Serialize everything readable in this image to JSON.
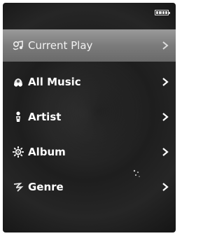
{
  "status_bar": {
    "battery_icon": "battery-full-icon",
    "battery_level": 1.0
  },
  "menu": {
    "items": [
      {
        "label": "Current Play",
        "icon": "now-playing-icon",
        "selected": true
      },
      {
        "label": "All Music",
        "icon": "music-notes-icon",
        "selected": false
      },
      {
        "label": "Artist",
        "icon": "artist-icon",
        "selected": false
      },
      {
        "label": "Album",
        "icon": "album-icon",
        "selected": false
      },
      {
        "label": "Genre",
        "icon": "genre-icon",
        "selected": false
      }
    ],
    "chevron_icon": "chevron-right-icon"
  },
  "colors": {
    "selected_bar": "#8a8a8a",
    "text": "#ffffff",
    "background": "#222222"
  }
}
